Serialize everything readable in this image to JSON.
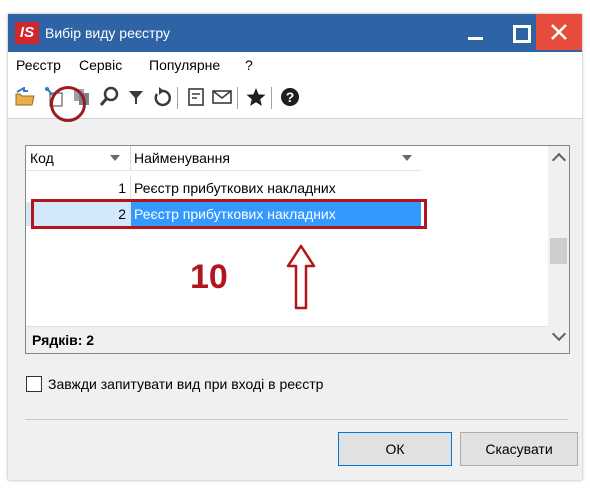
{
  "window": {
    "app_logo": "IS",
    "title": "Вибір виду реєстру"
  },
  "menu": [
    "Реєстр",
    "Сервіс",
    "Популярне",
    "?"
  ],
  "grid": {
    "headers": {
      "code": "Код",
      "name": "Найменування"
    },
    "rows": [
      {
        "code": "1",
        "name": "Реєстр прибуткових накладних"
      },
      {
        "code": "2",
        "name": "Реєстр прибуткових накладних"
      }
    ],
    "count_label": "Рядків: 2"
  },
  "annotation": {
    "step_number": "10"
  },
  "checkbox": {
    "label": "Завжди запитувати вид при вході в реєстр",
    "checked": false
  },
  "buttons": {
    "ok": "ОК",
    "cancel": "Скасувати"
  },
  "colors": {
    "titlebar": "#2e64a6",
    "accent_red": "#b3151c",
    "selection": "#3399ff",
    "close_button": "#e74c3c"
  }
}
